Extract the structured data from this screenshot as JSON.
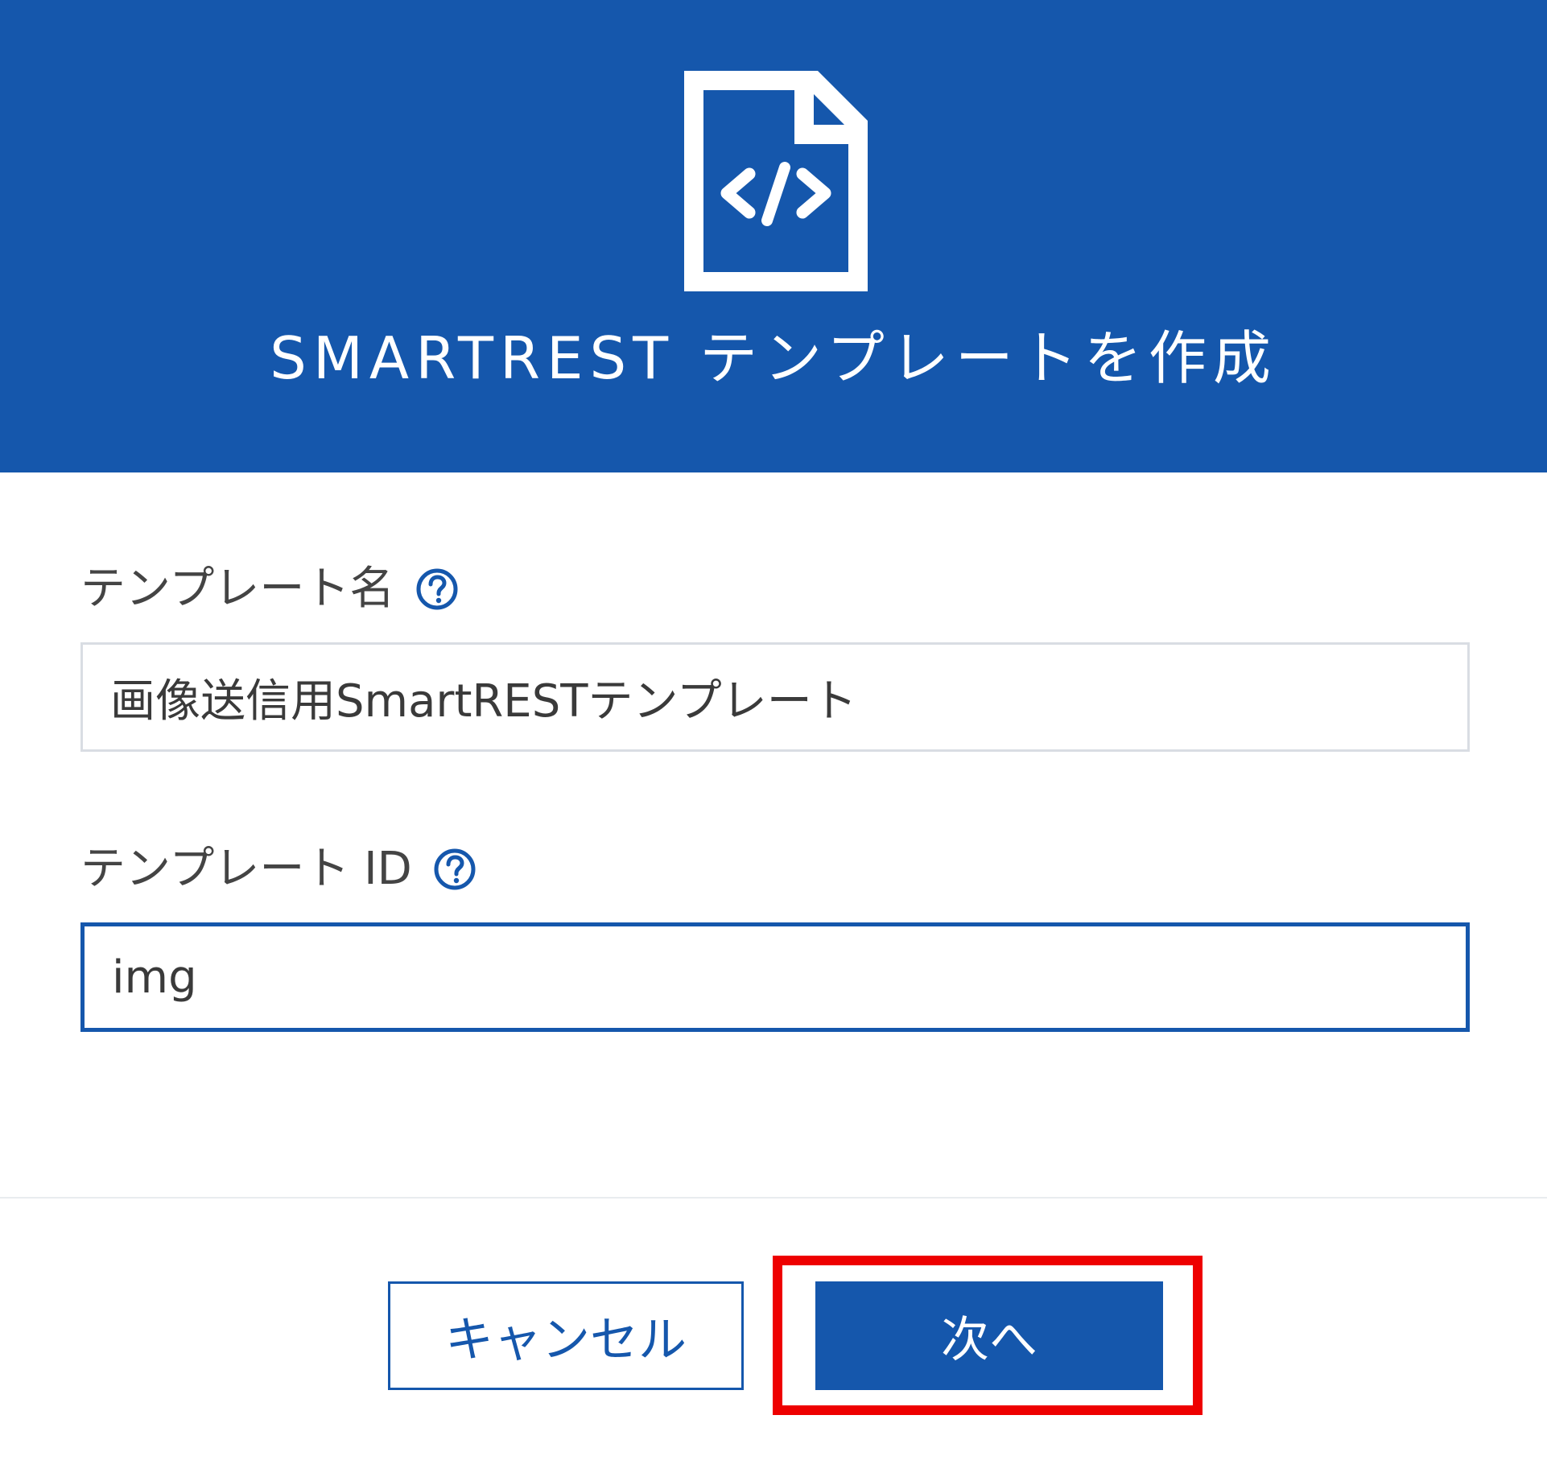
{
  "dialog": {
    "title": "SMARTREST テンプレートを作成",
    "icon": "code-file-icon",
    "colors": {
      "header_bg": "#1557ac",
      "accent": "#1557ac",
      "highlight": "#ee0000"
    }
  },
  "form": {
    "template_name": {
      "label": "テンプレート名",
      "value": "画像送信用SmartRESTテンプレート",
      "help_icon": "question-circle-icon"
    },
    "template_id": {
      "label": "テンプレート ID",
      "value": "img",
      "help_icon": "question-circle-icon"
    }
  },
  "footer": {
    "cancel_label": "キャンセル",
    "next_label": "次へ"
  }
}
